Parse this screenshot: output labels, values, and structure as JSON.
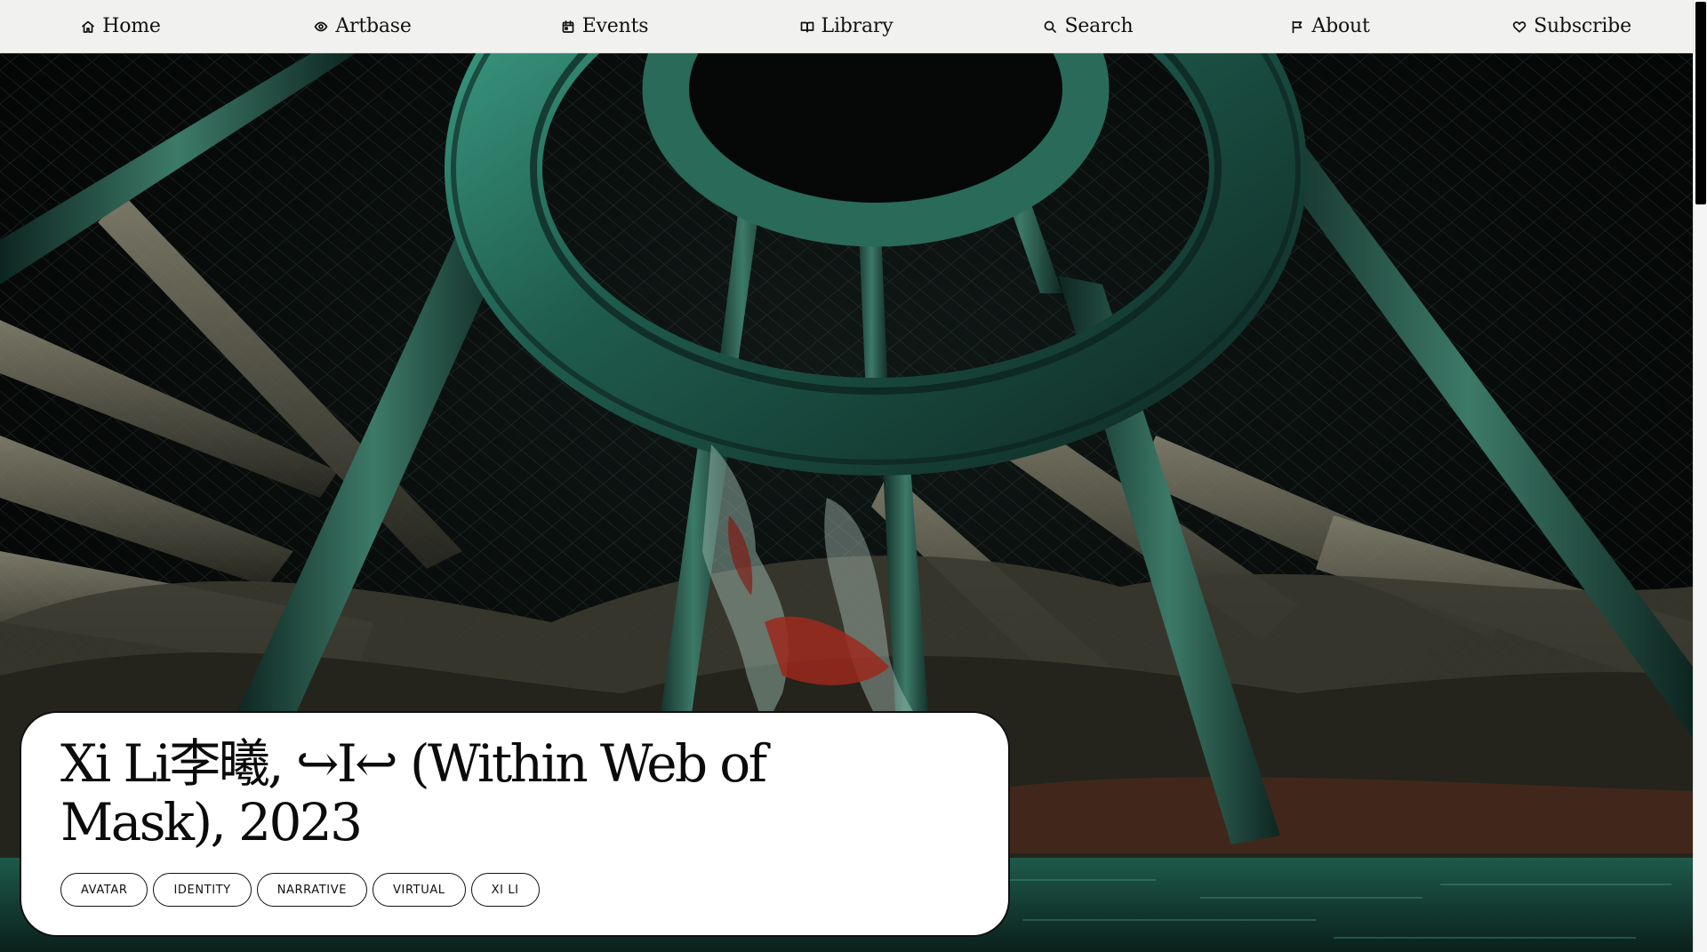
{
  "nav": {
    "items": [
      {
        "label": "Home",
        "icon": "home-icon"
      },
      {
        "label": "Artbase",
        "icon": "eye-icon"
      },
      {
        "label": "Events",
        "icon": "calendar-icon"
      },
      {
        "label": "Library",
        "icon": "book-icon"
      },
      {
        "label": "Search",
        "icon": "search-icon"
      },
      {
        "label": "About",
        "icon": "flag-icon"
      },
      {
        "label": "Subscribe",
        "icon": "heart-icon"
      }
    ]
  },
  "artwork": {
    "title": "Xi Li李曦, ↪I↩ (Within Web of Mask), 2023",
    "tags": [
      "AVATAR",
      "IDENTITY",
      "NARRATIVE",
      "VIRTUAL",
      "XI LI"
    ]
  },
  "colors": {
    "nav_background": "#f1f1ef",
    "card_background": "#ffffff",
    "text": "#0b0b0b",
    "artwork_green": "#1f4f44"
  }
}
